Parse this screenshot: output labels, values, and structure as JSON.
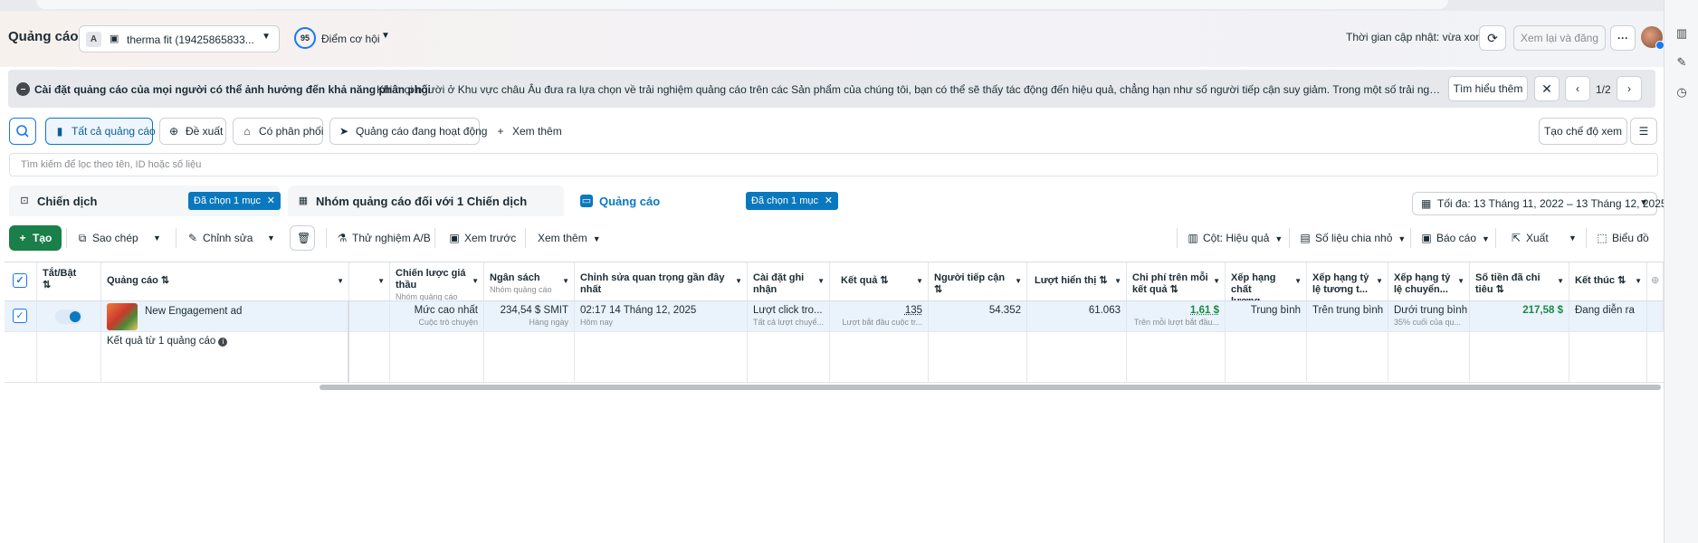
{
  "header": {
    "title": "Quảng cáo",
    "account_badge": "A",
    "account_name": "therma fit (19425865833...",
    "opportunity_score": "95",
    "opportunity_label": "Điểm cơ hội",
    "updated_text": "Thời gian cập nhật: vừa xong",
    "review_publish_label": "Xem lại và đăng",
    "more_label": "···"
  },
  "notice": {
    "bold_text": "Cài đặt quảng cáo của mọi người có thể ảnh hưởng đến khả năng phân phối",
    "text": "Khi mọi người ở Khu vực châu Âu đưa ra lựa chọn về trải nghiệm quảng cáo trên các Sản phẩm của chúng tôi, bạn có thể sẽ thấy tác động đến hiệu quả, chẳng hạn như số người tiếp cận suy giảm. Trong một số trải nghiệm mới như quảng cáo được cá ...",
    "learn_more": "Tìm hiểu thêm",
    "pager": "1/2"
  },
  "filters": {
    "items": [
      {
        "label": "Tất cả quảng cáo"
      },
      {
        "label": "Đề xuất"
      },
      {
        "label": "Có phân phối"
      },
      {
        "label": "Quảng cáo đang hoạt động"
      }
    ],
    "see_more": "Xem thêm",
    "create_view": "Tạo chế độ xem",
    "search_placeholder": "Tìm kiếm để lọc theo tên, ID hoặc số liệu"
  },
  "levels": {
    "campaign": {
      "label": "Chiến dịch",
      "chip": "Đã chọn 1 mục"
    },
    "adset": {
      "label": "Nhóm quảng cáo đối với 1 Chiến dịch"
    },
    "ad": {
      "label": "Quảng cáo",
      "chip": "Đã chọn 1 mục"
    },
    "date_range": "Tối đa: 13 Tháng 11, 2022 – 13 Tháng 12, 2025"
  },
  "toolbar": {
    "create": "Tạo",
    "copy": "Sao chép",
    "edit": "Chỉnh sửa",
    "ab_test": "Thử nghiệm A/B",
    "preview": "Xem trước",
    "see_more": "Xem thêm",
    "columns": "Cột: Hiệu quả",
    "breakdown": "Số liệu chia nhỏ",
    "reports": "Báo cáo",
    "export": "Xuất",
    "charts": "Biểu đồ"
  },
  "table": {
    "headers": {
      "toggle": "Tắt/Bật",
      "ad": "Quảng cáo",
      "bid": "Chiến lược giá thầu",
      "bid_sub": "Nhóm quảng cáo",
      "budget": "Ngân sách",
      "budget_sub": "Nhóm quảng cáo",
      "last_edit": "Chỉnh sửa quan trọng gần đây nhất",
      "attribution": "Cài đặt ghi nhận",
      "results": "Kết quả",
      "reach": "Người tiếp cận",
      "impressions": "Lượt hiển thị",
      "cost_per_result": "Chi phí trên mỗi kết quả",
      "quality": "Xếp hạng chất lượng...",
      "engagement_rank": "Xếp hạng tỷ lệ tương t...",
      "conversion_rank": "Xếp hạng tỷ lệ chuyển...",
      "spent": "Số tiền đã chi tiêu",
      "ends": "Kết thúc"
    },
    "row": {
      "name": "New Engagement ad",
      "bid": "Mức cao nhất",
      "bid_sub": "Cuộc trò chuyện",
      "budget": "234,54 $ SMIT",
      "budget_sub": "Hàng ngày",
      "last_edit": "02:17 14 Tháng 12, 2025",
      "last_edit_sub": "Hôm nay",
      "attribution": "Lượt click tro...",
      "attribution_sub": "Tất cả lượt chuyể...",
      "results": "135",
      "results_sub": "Lượt bắt đầu cuộc tr...",
      "reach": "54.352",
      "impressions": "61.063",
      "cost_per_result": "1,61 $",
      "cost_sub": "Trên mỗi lượt bắt đầu...",
      "quality": "Trung bình",
      "engagement_rank": "Trên trung bình",
      "conversion_rank": "Dưới trung bình",
      "conversion_sub": "35% cuối của qu...",
      "spent": "217,58 $",
      "ends": "Đang diễn ra"
    },
    "summary": "Kết quả từ 1 quảng cáo"
  },
  "colors": {
    "primary": "#1a7f48",
    "accent": "#0a78be",
    "notice_bg": "#e6e8ec"
  }
}
